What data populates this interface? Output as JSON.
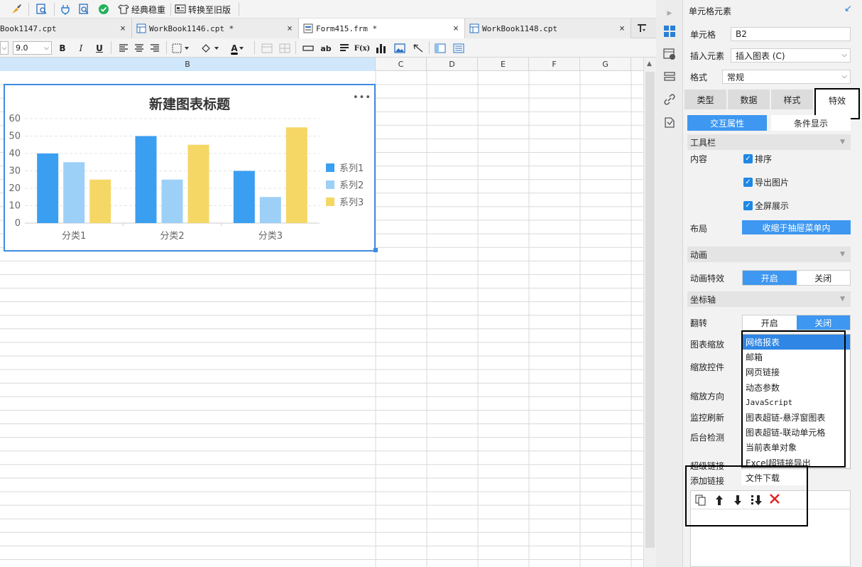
{
  "toolbar": {
    "classic_label": "经典稳重",
    "convert_label": "转换至旧版"
  },
  "tabs": [
    {
      "label": "Book1147.cpt",
      "close": "×"
    },
    {
      "label": "WorkBook1146.cpt *",
      "close": "×"
    },
    {
      "label": "Form415.frm *",
      "close": "×"
    },
    {
      "label": "WorkBook1148.cpt",
      "close": "×"
    }
  ],
  "format_toolbar": {
    "font_size": "9.0",
    "bold": "B",
    "italic": "I",
    "underline": "U",
    "text_color_glyph": "A",
    "ab_label": "ab",
    "fx_label": "F(x)"
  },
  "columns": [
    "B",
    "C",
    "D",
    "E",
    "F",
    "G"
  ],
  "chart_data": {
    "type": "bar",
    "title": "新建图表标题",
    "menu": "•••",
    "categories": [
      "分类1",
      "分类2",
      "分类3"
    ],
    "series": [
      {
        "name": "系列1",
        "values": [
          40,
          50,
          30
        ],
        "color": "#3a9ff1"
      },
      {
        "name": "系列2",
        "values": [
          35,
          25,
          15
        ],
        "color": "#9dd0f7"
      },
      {
        "name": "系列3",
        "values": [
          25,
          45,
          55
        ],
        "color": "#f5d766"
      }
    ],
    "yticks": [
      "0",
      "10",
      "20",
      "30",
      "40",
      "50",
      "60"
    ],
    "ylim": [
      0,
      60
    ],
    "legend_position": "right",
    "grid": true
  },
  "panel": {
    "header_title": "单元格元素",
    "cell_label": "单元格",
    "cell_value": "B2",
    "insert_label": "插入元素",
    "insert_value": "插入图表 (C)",
    "style_label": "格式",
    "style_value": "常规",
    "tabs": [
      "类型",
      "数据",
      "样式",
      "特效"
    ],
    "subtabs": [
      "交互属性",
      "条件显示"
    ],
    "toolbar_section": "工具栏",
    "content_label": "内容",
    "checkbox_sort": "排序",
    "checkbox_export": "导出图片",
    "checkbox_fullscreen": "全屏展示",
    "layout_label": "布局",
    "layout_value": "收缩于抽屉菜单内",
    "animation_section": "动画",
    "animation_label": "动画特效",
    "on": "开启",
    "off": "关闭",
    "axis_section": "坐标轴",
    "flip_label": "翻转",
    "zoom_label": "图表缩放",
    "zoom_control_label": "缩放控件",
    "zoom_direction_label": "缩放方向",
    "monitor_section": "监控刷新",
    "backend_label": "后台检测",
    "hyperlink_section": "超级链接",
    "add_link_label": "添加链接",
    "check_mark": "✓"
  },
  "dropdown_items": [
    "网络报表",
    "邮箱",
    "网页链接",
    "动态参数",
    "JavaScript",
    "图表超链-悬浮窗图表",
    "图表超链-联动单元格",
    "当前表单对象",
    "Excel超链接导出",
    "文件下载"
  ]
}
